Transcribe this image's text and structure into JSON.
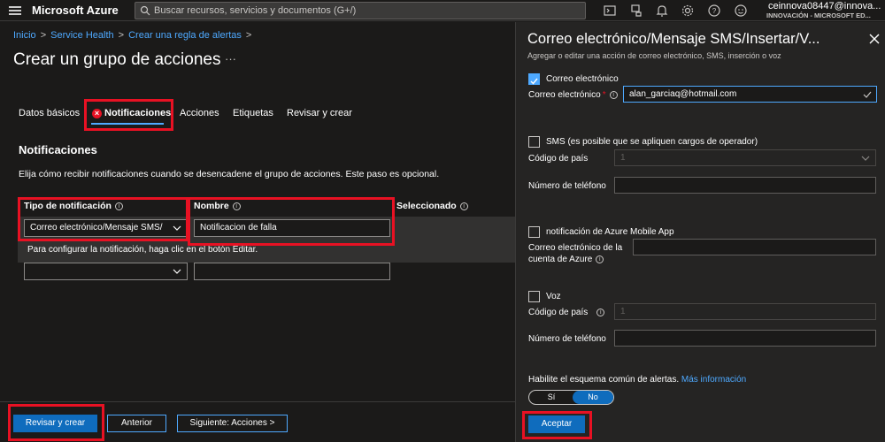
{
  "topbar": {
    "brand": "Microsoft Azure",
    "search_placeholder": "Buscar recursos, servicios y documentos (G+/)",
    "account_name": "ceinnova08447@innova...",
    "account_org": "INNOVACIÓN - MICROSOFT ED...",
    "icons": [
      "cloud-shell-icon",
      "directory-filter-icon",
      "bell-icon",
      "gear-icon",
      "help-icon",
      "feedback-icon"
    ]
  },
  "breadcrumb": {
    "items": [
      "Inicio",
      "Service Health",
      "Crear una regla de alertas"
    ],
    "sep": ">"
  },
  "page": {
    "title": "Crear un grupo de acciones",
    "more": "···"
  },
  "tabs": [
    {
      "label": "Datos básicos"
    },
    {
      "label": "Notificaciones"
    },
    {
      "label": "Acciones"
    },
    {
      "label": "Etiquetas"
    },
    {
      "label": "Revisar y crear"
    }
  ],
  "section": {
    "title": "Notificaciones",
    "description": "Elija cómo recibir notificaciones cuando se desencadene el grupo de acciones. Este paso es opcional."
  },
  "table": {
    "columns": [
      "Tipo de notificación",
      "Nombre",
      "Seleccionado"
    ],
    "row1": {
      "type": "Correo electrónico/Mensaje SMS/I...",
      "name": "Notificacion de falla",
      "hint": "Para configurar la notificación, haga clic en el botón Editar."
    },
    "row2": {
      "type": "",
      "name": ""
    }
  },
  "footer": {
    "review_label": "Revisar y crear",
    "prev_label": "Anterior",
    "next_label": "Siguiente: Acciones >"
  },
  "panel": {
    "title": "Correo electrónico/Mensaje SMS/Insertar/V...",
    "subtitle": "Agregar o editar una acción de correo electrónico, SMS, inserción o voz",
    "email_check_label": "Correo electrónico",
    "email_check_value": true,
    "email_field_label": "Correo electrónico",
    "email_required": "*",
    "email_value": "alan_garciaq@hotmail.com",
    "sms_check_label": "SMS (es posible que se apliquen cargos de operador)",
    "sms_country_label": "Código de país",
    "sms_country_value": "1",
    "sms_phone_label": "Número de teléfono",
    "push_check_label": "notificación de Azure Mobile App",
    "push_email_label_1": "Correo electrónico de la",
    "push_email_label_2": "cuenta de Azure",
    "voice_check_label": "Voz",
    "voice_country_label": "Código de país",
    "voice_country_value": "1",
    "voice_phone_label": "Número de teléfono",
    "schema_label": "Habilite el esquema común de alertas.",
    "schema_link": "Más información",
    "toggle_yes": "Sí",
    "toggle_no": "No",
    "toggle_selected": "No",
    "accept_label": "Aceptar"
  },
  "colors": {
    "accent": "#0f6cbd",
    "link": "#4ea9ff",
    "highlight": "#e81123",
    "background": "#1b1a19"
  }
}
